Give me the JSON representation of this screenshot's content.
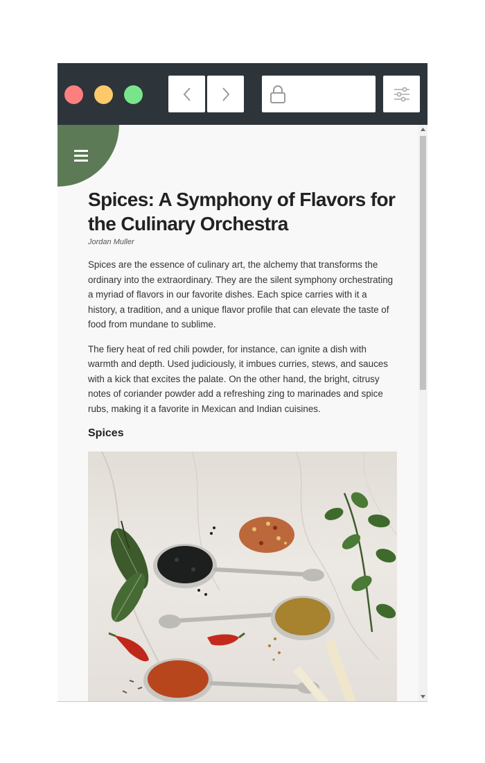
{
  "window": {
    "traffic_lights": {
      "close_color": "#fe7f7d",
      "minimize_color": "#fdc96a",
      "maximize_color": "#79e58b"
    },
    "address_bar": {
      "url": "",
      "icon": "lock-icon"
    },
    "icons": {
      "back": "chevron-left-icon",
      "forward": "chevron-right-icon",
      "settings": "sliders-icon",
      "menu": "hamburger-menu-icon"
    },
    "accent_color": "#5c7a55",
    "titlebar_color": "#2d353b"
  },
  "article": {
    "title": "Spices: A Symphony of Flavors for the Culinary Orchestra",
    "author": "Jordan Muller",
    "paragraphs": [
      "Spices are the essence of culinary art, the alchemy that transforms the ordinary into the extraordinary. They are the silent symphony orchestrating a myriad of flavors in our favorite dishes. Each spice carries with it a history, a tradition, and a unique flavor profile that can elevate the taste of food from mundane to sublime.",
      "The fiery heat of red chili powder, for instance, can ignite a dish with warmth and depth. Used judiciously, it imbues curries, stews, and sauces with a kick that excites the palate. On the other hand, the bright, citrusy notes of coriander powder add a refreshing zing to marinades and spice rubs, making it a favorite in Mexican and Indian cuisines."
    ],
    "section_heading": "Spices",
    "image_subject": "spoons-of-spices-photo"
  },
  "scrollbar": {
    "position_fraction": 0
  }
}
